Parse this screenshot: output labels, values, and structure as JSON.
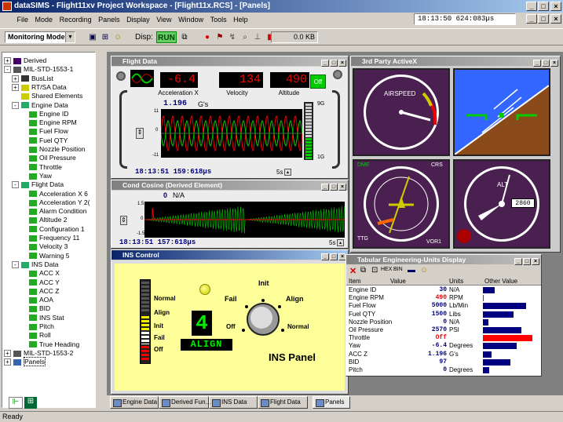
{
  "app": {
    "title": "dataSIMS - Flight11xv Project Workspace - [Flight11x.RCS] - [Panels]",
    "clock": "18:13:50 624:083µs",
    "mode": "Monitoring Mode",
    "disp": "Disp:",
    "run": "RUN",
    "kb": "0.0 KB",
    "status": "Ready"
  },
  "menu": [
    "File",
    "Mode",
    "Recording",
    "Panels",
    "Display",
    "View",
    "Window",
    "Tools",
    "Help"
  ],
  "tree": [
    {
      "label": "Derived",
      "lvl": 0,
      "pm": "+",
      "icon": "fx"
    },
    {
      "label": "MIL-STD-1553-1",
      "lvl": 0,
      "pm": "-",
      "icon": "bus"
    },
    {
      "label": "BusList",
      "lvl": 1,
      "pm": "+",
      "icon": "grid"
    },
    {
      "label": "RT/SA Data",
      "lvl": 1,
      "pm": "+",
      "icon": "rt"
    },
    {
      "label": "Shared Elements",
      "lvl": 1,
      "pm": "",
      "icon": "rt"
    },
    {
      "label": "Engine Data",
      "lvl": 1,
      "pm": "-",
      "icon": "grp"
    },
    {
      "label": "Engine ID",
      "lvl": 2,
      "pm": "",
      "icon": "el"
    },
    {
      "label": "Engine RPM",
      "lvl": 2,
      "pm": "",
      "icon": "el"
    },
    {
      "label": "Fuel Flow",
      "lvl": 2,
      "pm": "",
      "icon": "el"
    },
    {
      "label": "Fuel QTY",
      "lvl": 2,
      "pm": "",
      "icon": "el"
    },
    {
      "label": "Nozzle Position",
      "lvl": 2,
      "pm": "",
      "icon": "el"
    },
    {
      "label": "Oil Pressure",
      "lvl": 2,
      "pm": "",
      "icon": "el"
    },
    {
      "label": "Throttle",
      "lvl": 2,
      "pm": "",
      "icon": "el"
    },
    {
      "label": "Yaw",
      "lvl": 2,
      "pm": "",
      "icon": "el"
    },
    {
      "label": "Flight Data",
      "lvl": 1,
      "pm": "-",
      "icon": "grp"
    },
    {
      "label": "Acceleration X 6",
      "lvl": 2,
      "pm": "",
      "icon": "el"
    },
    {
      "label": "Acceleration Y 2(",
      "lvl": 2,
      "pm": "",
      "icon": "el"
    },
    {
      "label": "Alarm Condition",
      "lvl": 2,
      "pm": "",
      "icon": "el"
    },
    {
      "label": "Altitude 2",
      "lvl": 2,
      "pm": "",
      "icon": "el"
    },
    {
      "label": "Configuration 1",
      "lvl": 2,
      "pm": "",
      "icon": "el"
    },
    {
      "label": "Frequency 11",
      "lvl": 2,
      "pm": "",
      "icon": "el"
    },
    {
      "label": "Velocity 3",
      "lvl": 2,
      "pm": "",
      "icon": "el"
    },
    {
      "label": "Warning 5",
      "lvl": 2,
      "pm": "",
      "icon": "el"
    },
    {
      "label": "INS Data",
      "lvl": 1,
      "pm": "-",
      "icon": "grp"
    },
    {
      "label": "ACC X",
      "lvl": 2,
      "pm": "",
      "icon": "el"
    },
    {
      "label": "ACC Y",
      "lvl": 2,
      "pm": "",
      "icon": "el"
    },
    {
      "label": "ACC Z",
      "lvl": 2,
      "pm": "",
      "icon": "el"
    },
    {
      "label": "AOA",
      "lvl": 2,
      "pm": "",
      "icon": "el"
    },
    {
      "label": "BID",
      "lvl": 2,
      "pm": "",
      "icon": "el"
    },
    {
      "label": "INS Stat",
      "lvl": 2,
      "pm": "",
      "icon": "el"
    },
    {
      "label": "Pitch",
      "lvl": 2,
      "pm": "",
      "icon": "el"
    },
    {
      "label": "Roll",
      "lvl": 2,
      "pm": "",
      "icon": "el"
    },
    {
      "label": "True Heading",
      "lvl": 2,
      "pm": "",
      "icon": "el"
    },
    {
      "label": "MIL-STD-1553-2",
      "lvl": 0,
      "pm": "+",
      "icon": "bus"
    },
    {
      "label": "Panels",
      "lvl": 0,
      "pm": "+",
      "icon": "panel",
      "selected": true
    }
  ],
  "flight": {
    "title": "Flight Data",
    "accel": "-6.4",
    "vel": "134",
    "alt": "490",
    "accel_lbl": "Acceleration X",
    "vel_lbl": "Velocity",
    "alt_lbl": "Altitude",
    "off": "Off",
    "gval": "1.196",
    "gunit": "G's",
    "ts": "18:13:51 159:618µs",
    "span": "5s",
    "y_top": "11",
    "y_mid": "0",
    "y_bot": "-11",
    "g9": "9G",
    "g1": "1G"
  },
  "cond": {
    "title": "Cond Cosine (Derived Element)",
    "val": "0",
    "unit": "N/A",
    "y_top": "1.5",
    "y_mid": "0",
    "y_bot": "-1.5",
    "ts": "18:13:51 157:618µs",
    "span": "5s"
  },
  "ins": {
    "title": "INS Control",
    "num": "4",
    "mode": "ALIGN",
    "panel": "INS Panel",
    "scale": [
      "Normal",
      "Align",
      "Init",
      "Fail",
      "Off"
    ],
    "knob": {
      "init": "Init",
      "fail": "Fail",
      "align": "Align",
      "off": "Off",
      "normal": "Normal"
    }
  },
  "activex": {
    "title": "3rd Party ActiveX",
    "airspeed": "AIRSPEED",
    "alt": "ALT",
    "alt_digits": "2860",
    "ttg": "TTG",
    "crs": "CRS",
    "vor": "VOR1",
    "dme": "DME"
  },
  "eu": {
    "title": "Tabular Engineering-Units Display",
    "hex": "HEX",
    "bin": "BIN",
    "cols": [
      "Item",
      "Value",
      "Units",
      "Other Value"
    ],
    "rows": [
      {
        "item": "Engine ID",
        "value": "30",
        "units": "N/A",
        "bar": 0.22,
        "color": "#000080"
      },
      {
        "item": "Engine RPM",
        "value": "490",
        "units": "RPM",
        "bar": 0.02,
        "color": "#ff0000",
        "red": true
      },
      {
        "item": "Fuel Flow",
        "value": "5000",
        "units": "Lb/Min",
        "bar": 0.78,
        "color": "#000080"
      },
      {
        "item": "Fuel QTY",
        "value": "1500",
        "units": "Libs",
        "bar": 0.55,
        "color": "#000080"
      },
      {
        "item": "Nozzle Position",
        "value": "0",
        "units": "N/A",
        "bar": 0.1,
        "color": "#000080"
      },
      {
        "item": "Oil Pressure",
        "value": "2570",
        "units": "PSI",
        "bar": 0.7,
        "color": "#000080"
      },
      {
        "item": "Throttle",
        "value": "Off",
        "units": "",
        "bar": 0.9,
        "color": "#ff0000",
        "red": true
      },
      {
        "item": "Yaw",
        "value": "-6.4",
        "units": "Degrees",
        "bar": 0.62,
        "color": "#000080"
      },
      {
        "item": "ACC Z",
        "value": "1.196",
        "units": "G's",
        "bar": 0.16,
        "color": "#000080"
      },
      {
        "item": "BID",
        "value": "97",
        "units": "",
        "bar": 0.5,
        "color": "#000080"
      },
      {
        "item": "Pitch",
        "value": "0",
        "units": "Degrees",
        "bar": 0.12,
        "color": "#000080"
      }
    ]
  },
  "tabs": [
    "Engine Data",
    "Derived Fun...",
    "INS Data",
    "Flight Data",
    "Panels"
  ]
}
